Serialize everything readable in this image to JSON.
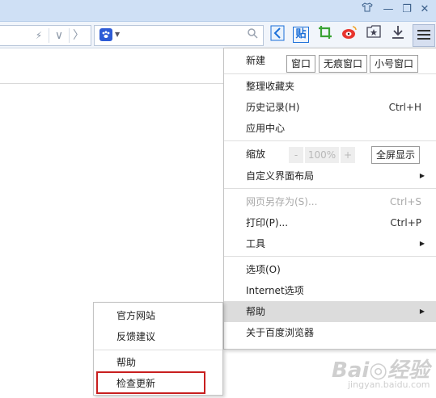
{
  "titlebar": {
    "shirt_icon": "shirt-icon",
    "minimize_glyph": "—",
    "restore_glyph": "❐",
    "close_glyph": "✕"
  },
  "toolbar": {
    "bolt_glyph": "⚡",
    "chevron_down_glyph": "∨",
    "chevron_right_glyph": "〉",
    "search_engine_glyph": "🐾",
    "search_icon_glyph": "⚲",
    "tool_share_glyph": "◁",
    "tool_tie_label": "贴",
    "tool_crop_glyph": "⛶",
    "tool_weibo_glyph": "◉",
    "tool_favorite_glyph": "★",
    "tool_download_glyph": "⤓",
    "tool_menu_glyph": "☰"
  },
  "menu": {
    "new_label": "新建",
    "new_window": "窗口",
    "new_private": "无痕窗口",
    "new_small": "小号窗口",
    "organize_favorites": "整理收藏夹",
    "history": "历史记录(H)",
    "history_shortcut": "Ctrl+H",
    "app_center": "应用中心",
    "zoom_label": "缩放",
    "zoom_minus": "-",
    "zoom_value": "100%",
    "zoom_plus": "+",
    "fullscreen": "全屏显示",
    "customize_layout": "自定义界面布局",
    "save_page_as": "网页另存为(S)...",
    "save_shortcut": "Ctrl+S",
    "print": "打印(P)...",
    "print_shortcut": "Ctrl+P",
    "tools": "工具",
    "options": "选项(O)",
    "internet_options": "Internet选项",
    "help": "帮助",
    "about": "关于百度浏览器"
  },
  "submenu": {
    "official_site": "官方网站",
    "feedback": "反馈建议",
    "help": "帮助",
    "check_update": "检查更新"
  },
  "watermark": {
    "logo": "Bai◎经验",
    "url": "jingyan.baidu.com"
  }
}
